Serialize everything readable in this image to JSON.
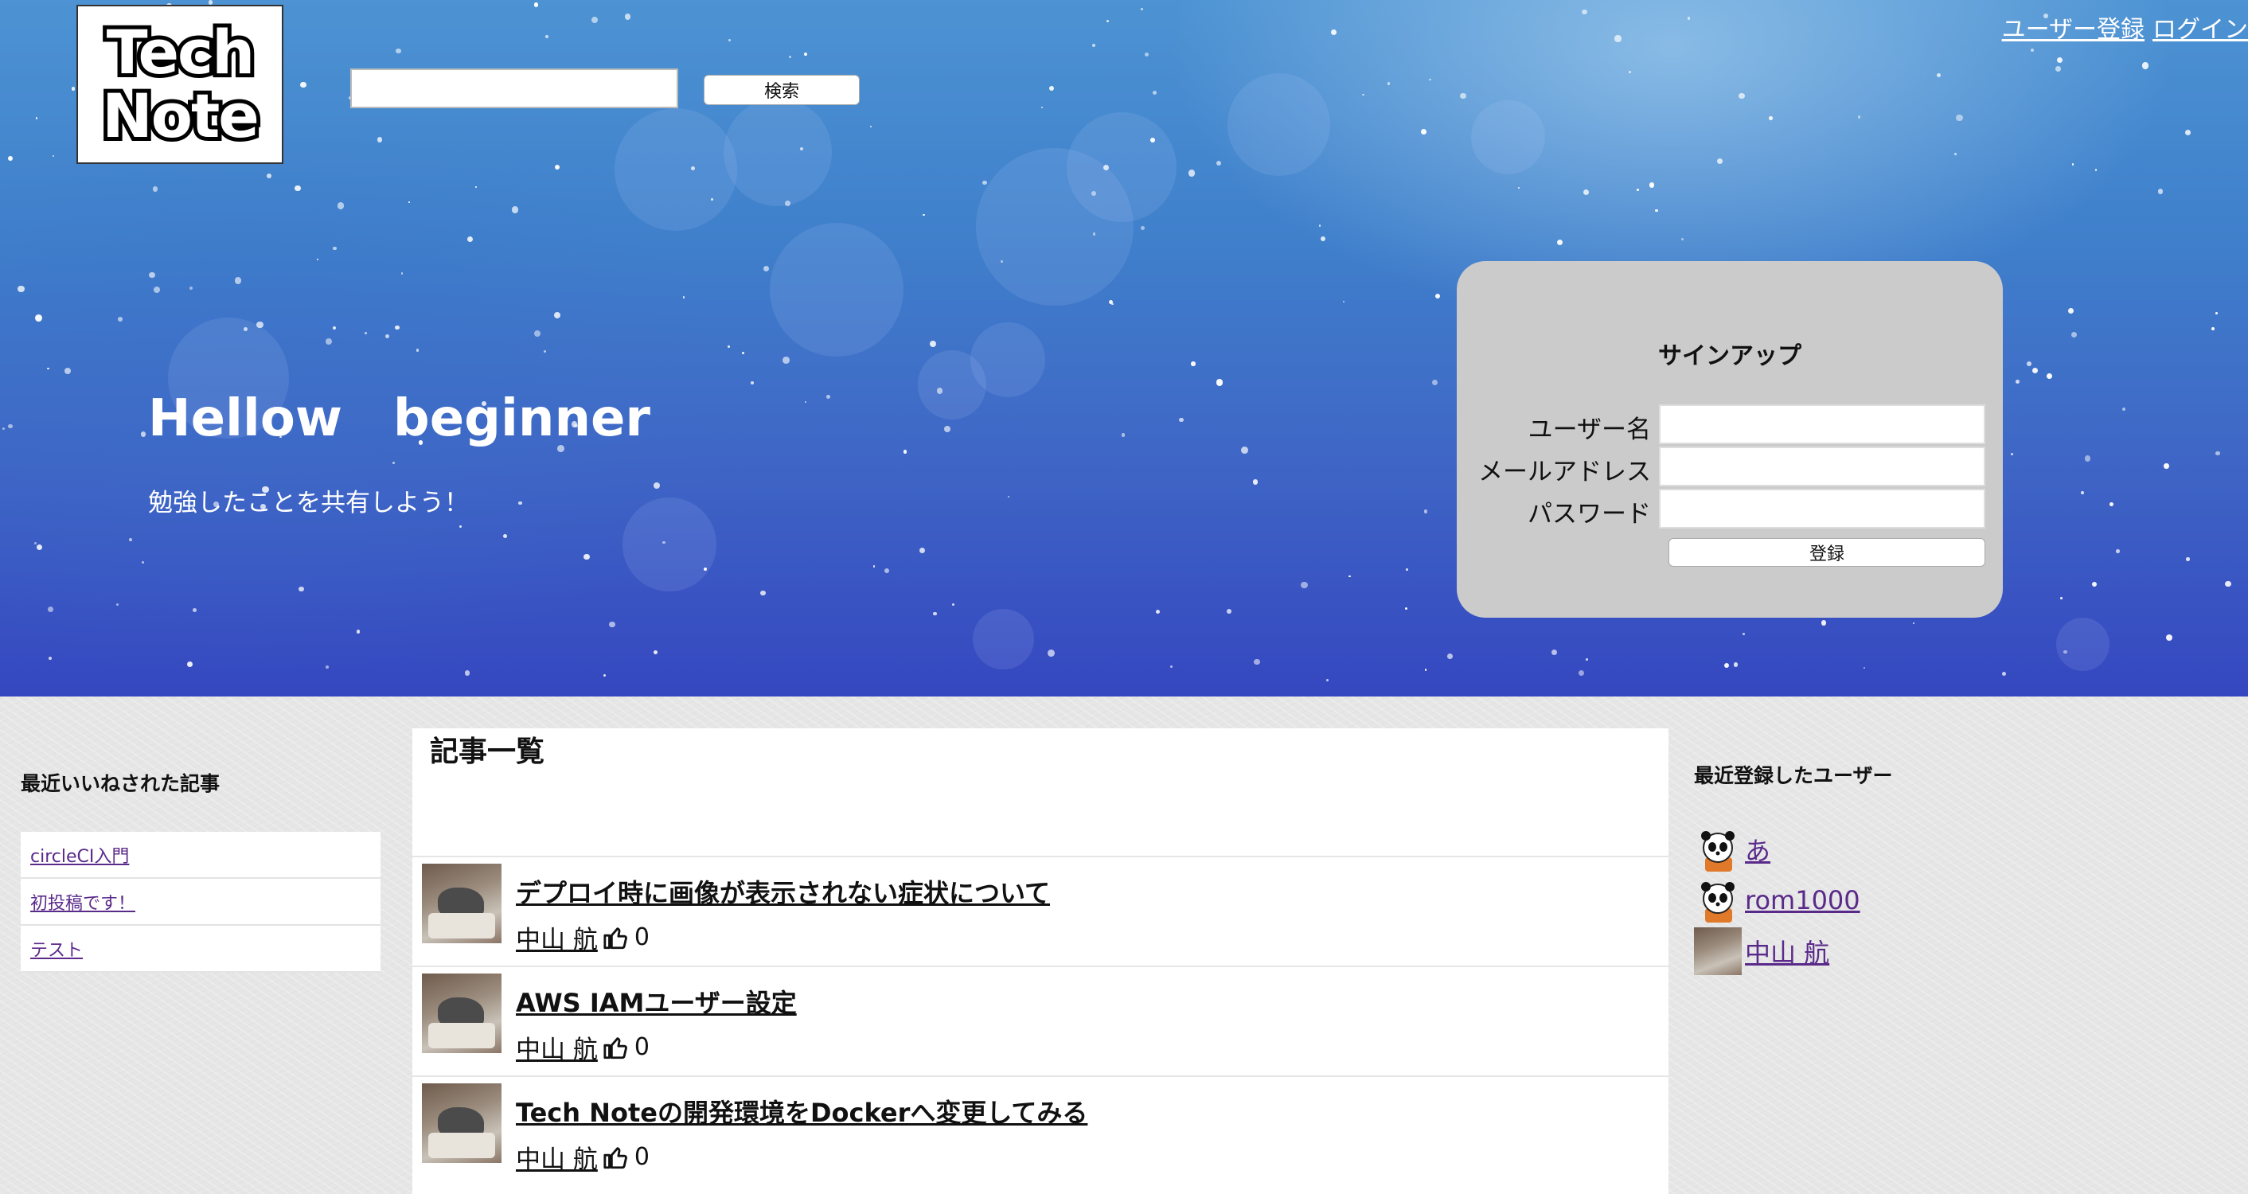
{
  "header": {
    "logo_line1": "Tech",
    "logo_line2": "Note",
    "search_placeholder": "",
    "search_button": "検索",
    "register_link": "ユーザー登録",
    "login_link": "ログイン"
  },
  "hero": {
    "title": "Hellow　beginner",
    "subtitle": "勉強したことを共有しよう！"
  },
  "signup": {
    "title": "サインアップ",
    "username_label": "ユーザー名",
    "email_label": "メールアドレス",
    "password_label": "パスワード",
    "submit": "登録"
  },
  "left": {
    "heading": "最近いいねされた記事",
    "items": [
      {
        "label": "circleCI入門"
      },
      {
        "label": "初投稿です！"
      },
      {
        "label": "テスト"
      }
    ]
  },
  "articles": {
    "heading": "記事一覧",
    "items": [
      {
        "title": "デプロイ時に画像が表示されない症状について",
        "author": "中山 航",
        "likes": "0"
      },
      {
        "title": "AWS IAMユーザー設定",
        "author": "中山 航",
        "likes": "0"
      },
      {
        "title": "Tech Noteの開発環境をDockerへ変更してみる",
        "author": "中山 航",
        "likes": "0"
      }
    ]
  },
  "right": {
    "heading": "最近登録したユーザー",
    "users": [
      {
        "name": "あ",
        "avatar": "panda-icon"
      },
      {
        "name": "rom1000",
        "avatar": "panda-icon"
      },
      {
        "name": "中山 航",
        "avatar": "photo"
      }
    ]
  },
  "colors": {
    "link": "#5a2a8a",
    "signup_panel": "#cbcbcb",
    "hero_top": "#4d93d3",
    "hero_bottom": "#3547c0"
  }
}
